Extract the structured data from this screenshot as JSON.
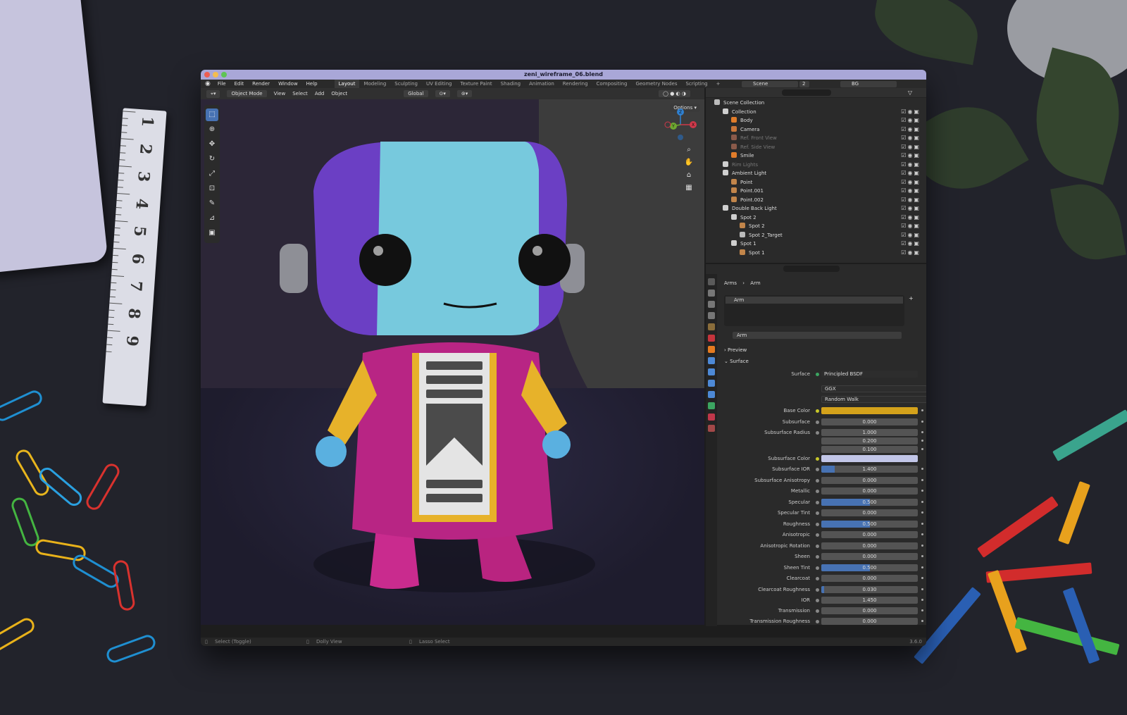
{
  "window": {
    "title": "zeni_wireframe_06.blend",
    "version": "3.6.0"
  },
  "menubar": {
    "menus": [
      "File",
      "Edit",
      "Render",
      "Window",
      "Help"
    ],
    "workspaces": [
      "Layout",
      "Modeling",
      "Sculpting",
      "UV Editing",
      "Texture Paint",
      "Shading",
      "Animation",
      "Rendering",
      "Compositing",
      "Geometry Nodes",
      "Scripting",
      "+"
    ],
    "active_workspace": "Layout",
    "scene": "Scene",
    "scene_users": "2",
    "view_layer": "BG"
  },
  "viewport": {
    "mode": "Object Mode",
    "menus": [
      "View",
      "Select",
      "Add",
      "Object"
    ],
    "orientation": "Global",
    "options_label": "Options",
    "gizmo_axes": [
      "X",
      "Y",
      "Z"
    ]
  },
  "statusbar": {
    "left": "Select (Toggle)",
    "middle": "Dolly View",
    "right": "Lasso Select",
    "version": "3.6.0"
  },
  "outliner": {
    "items": [
      {
        "label": "Scene Collection",
        "icon": "scene-collection-icon"
      },
      {
        "label": "Collection",
        "icon": "collection-icon"
      },
      {
        "label": "Body",
        "icon": "mesh-icon"
      },
      {
        "label": "Camera",
        "icon": "camera-icon"
      },
      {
        "label": "Ref. Front View",
        "icon": "image-icon",
        "dim": true
      },
      {
        "label": "Ref. Side View",
        "icon": "image-icon",
        "dim": true
      },
      {
        "label": "Smile",
        "icon": "mesh-icon"
      },
      {
        "label": "Rim Lights",
        "icon": "collection-icon",
        "dim": true
      },
      {
        "label": "Ambient Light",
        "icon": "collection-icon"
      },
      {
        "label": "Point",
        "icon": "light-icon"
      },
      {
        "label": "Point.001",
        "icon": "light-icon"
      },
      {
        "label": "Point.002",
        "icon": "light-icon"
      },
      {
        "label": "Double Back Light",
        "icon": "collection-icon"
      },
      {
        "label": "Spot 2",
        "icon": "collection-icon"
      },
      {
        "label": "Spot 2",
        "icon": "light-icon"
      },
      {
        "label": "Spot 2_Target",
        "icon": "empty-icon"
      },
      {
        "label": "Spot 1",
        "icon": "collection-icon"
      },
      {
        "label": "Spot 1",
        "icon": "light-icon"
      }
    ]
  },
  "properties": {
    "breadcrumb": [
      "Arms",
      "Arm"
    ],
    "material_slot": "Arm",
    "material_name": "Arm",
    "sections": {
      "preview": "Preview",
      "surface": "Surface"
    },
    "surface_label": "Surface",
    "surface_value": "Principled BSDF",
    "distribution": "GGX",
    "subsurface_method": "Random Walk",
    "base_color_label": "Base Color",
    "subsurface_color_label": "Subsurface Color",
    "colors": {
      "base_color": "#d4a21b",
      "subsurface_color": "#c2c6e8",
      "accent": "#4772b3"
    },
    "fields": [
      {
        "label": "Subsurface",
        "value": "0.000",
        "fill": 0
      },
      {
        "label": "Subsurface Radius",
        "value": "1.000",
        "fill": 0
      },
      {
        "label": "",
        "value": "0.200",
        "fill": 0
      },
      {
        "label": "",
        "value": "0.100",
        "fill": 0
      },
      {
        "label": "Subsurface IOR",
        "value": "1.400",
        "fill": 0.14
      },
      {
        "label": "Subsurface Anisotropy",
        "value": "0.000",
        "fill": 0
      },
      {
        "label": "Metallic",
        "value": "0.000",
        "fill": 0
      },
      {
        "label": "Specular",
        "value": "0.500",
        "fill": 0.5
      },
      {
        "label": "Specular Tint",
        "value": "0.000",
        "fill": 0
      },
      {
        "label": "Roughness",
        "value": "0.500",
        "fill": 0.5
      },
      {
        "label": "Anisotropic",
        "value": "0.000",
        "fill": 0
      },
      {
        "label": "Anisotropic Rotation",
        "value": "0.000",
        "fill": 0
      },
      {
        "label": "Sheen",
        "value": "0.000",
        "fill": 0
      },
      {
        "label": "Sheen Tint",
        "value": "0.500",
        "fill": 0.5
      },
      {
        "label": "Clearcoat",
        "value": "0.000",
        "fill": 0
      },
      {
        "label": "Clearcoat Roughness",
        "value": "0.030",
        "fill": 0.03
      },
      {
        "label": "IOR",
        "value": "1.450",
        "fill": 0
      },
      {
        "label": "Transmission",
        "value": "0.000",
        "fill": 0
      },
      {
        "label": "Transmission Roughness",
        "value": "0.000",
        "fill": 0
      }
    ]
  },
  "ruler": {
    "numbers": [
      "1",
      "2",
      "3",
      "4",
      "5",
      "6",
      "7",
      "8",
      "9"
    ]
  }
}
